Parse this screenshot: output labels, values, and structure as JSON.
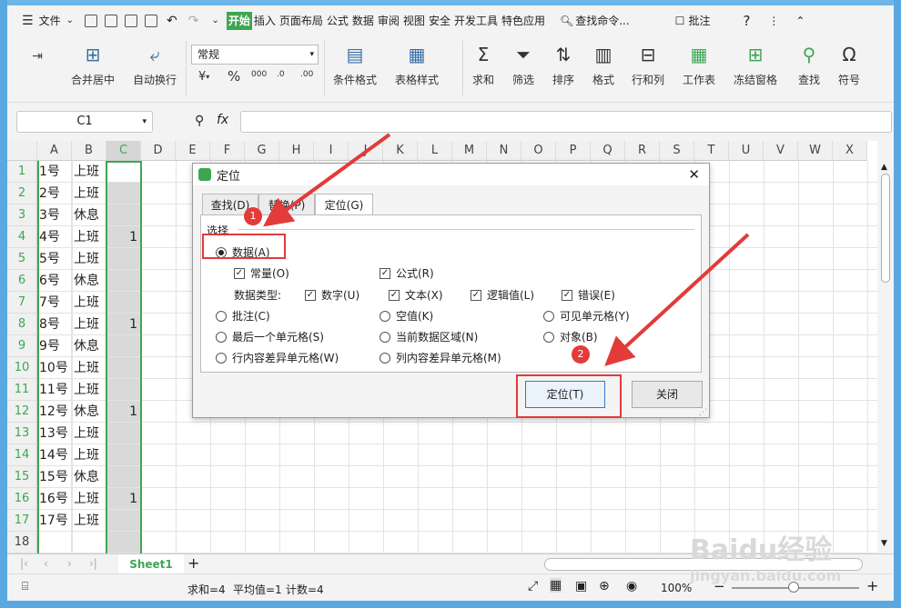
{
  "menubar": {
    "file": "文件",
    "tabs": [
      "开始",
      "插入",
      "页面布局",
      "公式",
      "数据",
      "审阅",
      "视图",
      "安全",
      "开发工具",
      "特色应用"
    ],
    "search": "查找命令...",
    "annotate": "批注",
    "help": "?"
  },
  "ribbon": {
    "merge_center": "合并居中",
    "wrap_text": "自动换行",
    "format_select": "常规",
    "pct": "%",
    "thousands": "000",
    "cond_format": "条件格式",
    "table_style": "表格样式",
    "sum": "求和",
    "filter": "筛选",
    "sort": "排序",
    "format": "格式",
    "rows_cols": "行和列",
    "worksheet": "工作表",
    "freeze": "冻结窗格",
    "find": "查找",
    "symbol": "符号"
  },
  "formula_bar": {
    "cell_ref": "C1",
    "fx": "fx"
  },
  "grid": {
    "columns": [
      "A",
      "B",
      "C",
      "D",
      "E",
      "F",
      "G",
      "H",
      "I",
      "J",
      "K",
      "L",
      "M",
      "N",
      "O",
      "P",
      "Q",
      "R",
      "S",
      "T",
      "U",
      "V",
      "W",
      "X"
    ],
    "rows": [
      "1",
      "2",
      "3",
      "4",
      "5",
      "6",
      "7",
      "8",
      "9",
      "10",
      "11",
      "12",
      "13",
      "14",
      "15",
      "16",
      "17",
      "18"
    ],
    "col_a": [
      "1号",
      "2号",
      "3号",
      "4号",
      "5号",
      "6号",
      "7号",
      "8号",
      "9号",
      "10号",
      "11号",
      "12号",
      "13号",
      "14号",
      "15号",
      "16号",
      "17号",
      ""
    ],
    "col_b": [
      "上班",
      "上班",
      "休息",
      "上班",
      "上班",
      "休息",
      "上班",
      "上班",
      "休息",
      "上班",
      "上班",
      "休息",
      "上班",
      "上班",
      "休息",
      "上班",
      "上班",
      ""
    ],
    "col_c": [
      "",
      "",
      "",
      "1",
      "",
      "",
      "",
      "1",
      "",
      "",
      "",
      "1",
      "",
      "",
      "",
      "1",
      "",
      ""
    ]
  },
  "sheets": {
    "active": "Sheet1",
    "add": "+"
  },
  "status": {
    "sum": "求和=4",
    "avg": "平均值=1",
    "count": "计数=4",
    "zoom": "100%"
  },
  "dialog": {
    "title": "定位",
    "tabs": [
      "查找(D)",
      "替换(P)",
      "定位(G)"
    ],
    "group": "选择",
    "data": "数据(A)",
    "constant": "常量(O)",
    "formula": "公式(R)",
    "data_type_label": "数据类型:",
    "number": "数字(U)",
    "text": "文本(X)",
    "logical": "逻辑值(L)",
    "error": "错误(E)",
    "comment": "批注(C)",
    "blank": "空值(K)",
    "visible": "可见单元格(Y)",
    "last_cell": "最后一个单元格(S)",
    "current_region": "当前数据区域(N)",
    "object": "对象(B)",
    "row_diff": "行内容差异单元格(W)",
    "col_diff": "列内容差异单元格(M)",
    "locate_btn": "定位(T)",
    "close_btn": "关闭"
  },
  "annotations": {
    "badge1": "1",
    "badge2": "2"
  },
  "watermark": {
    "line1": "Baidu经验",
    "line2": "jingyan.baidu.com"
  },
  "colors": {
    "accent": "#3ea653",
    "annotation": "#e33a3a",
    "frame": "#5aa8e0"
  }
}
